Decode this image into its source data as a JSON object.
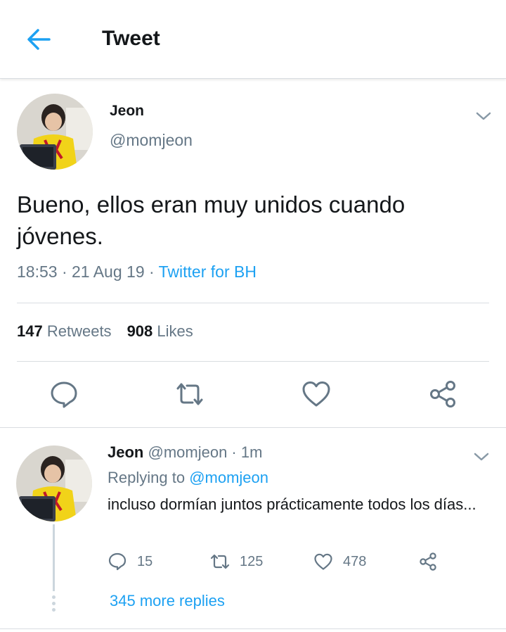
{
  "header": {
    "title": "Tweet"
  },
  "tweet": {
    "name": "Jeon",
    "handle": "@momjeon",
    "text": "Bueno, ellos eran muy unidos cuando jóvenes.",
    "time": "18:53",
    "date": "21 Aug 19",
    "client": "Twitter for BH",
    "retweets_count": "147",
    "retweets_label": "Retweets",
    "likes_count": "908",
    "likes_label": "Likes"
  },
  "reply": {
    "name": "Jeon",
    "handle": "@momjeon",
    "age": "1m",
    "replying_prefix": "Replying to",
    "replying_to": "@momjeon",
    "text": "incluso dormían juntos prácticamente todos los días...",
    "reply_count": "15",
    "retweet_count": "125",
    "like_count": "478",
    "more_replies": "345 more replies"
  },
  "icons": [
    "back-arrow-icon",
    "chevron-down-icon",
    "reply-icon",
    "retweet-icon",
    "heart-icon",
    "share-icon"
  ],
  "colors": {
    "accent": "#1da1f2",
    "secondary_text": "#657786",
    "primary_text": "#14171a",
    "divider": "#d9dde1"
  }
}
